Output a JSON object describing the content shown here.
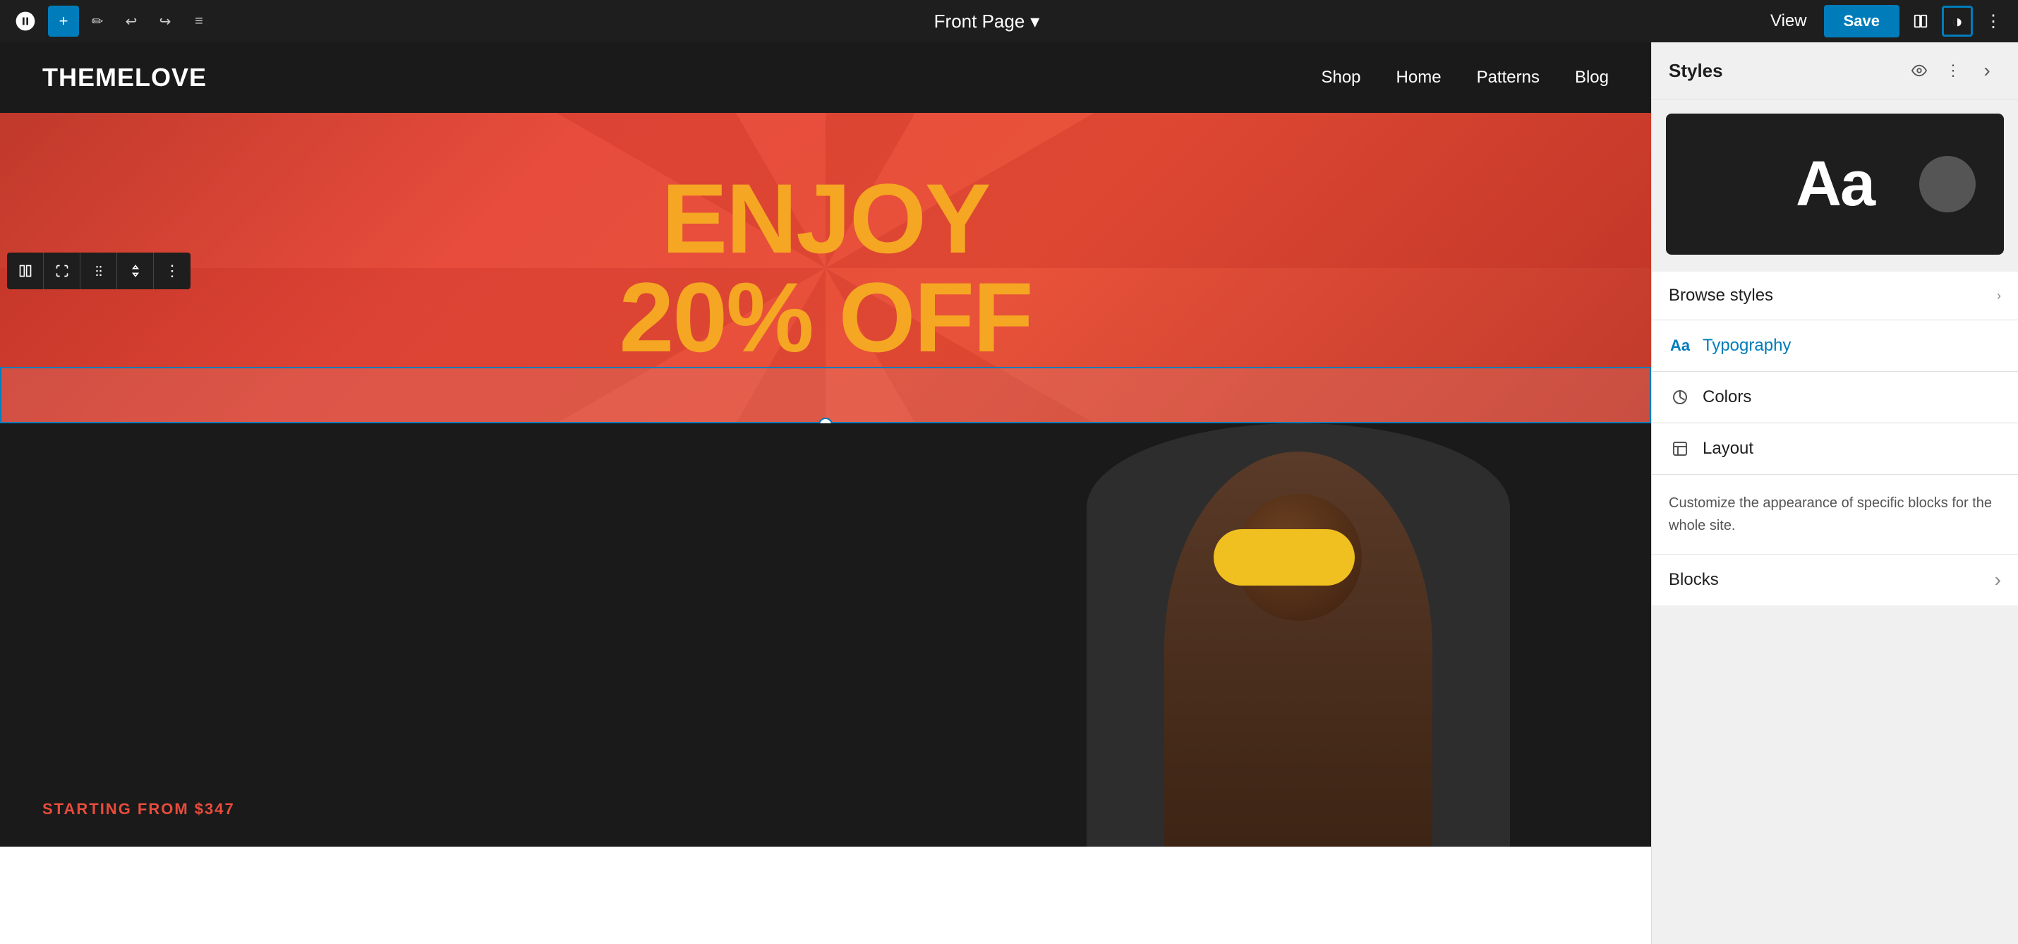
{
  "toolbar": {
    "page_title": "Front Page",
    "chevron": "▾",
    "view_label": "View",
    "save_label": "Save"
  },
  "site": {
    "logo": "THEMELOVE",
    "nav": [
      "Shop",
      "Home",
      "Patterns",
      "Blog"
    ]
  },
  "hero": {
    "line1": "ENJOY",
    "line2": "20% OFF"
  },
  "bottom": {
    "starting_from": "STARTING FROM $347"
  },
  "styles_panel": {
    "title": "Styles",
    "preview_aa": "Aa",
    "browse_styles_label": "Browse styles",
    "typography_label": "Typography",
    "colors_label": "Colors",
    "layout_label": "Layout",
    "description": "Customize the appearance of specific blocks for the whole site.",
    "blocks_label": "Blocks"
  },
  "icons": {
    "wp_logo": "W",
    "add": "+",
    "pen": "✏",
    "undo": "↩",
    "redo": "↪",
    "list": "≡",
    "eye": "👁",
    "more_vert": "⋮",
    "chevron_right": "›",
    "close_panel": "›",
    "contrast": "◑",
    "ellipsis_h": "•••",
    "columns": "⊞",
    "expand": "⛶",
    "drag": "⠿",
    "up_down": "⬍",
    "block_more": "⋮",
    "typography_icon": "Aa",
    "colors_icon": "◎",
    "layout_icon": "▣"
  }
}
